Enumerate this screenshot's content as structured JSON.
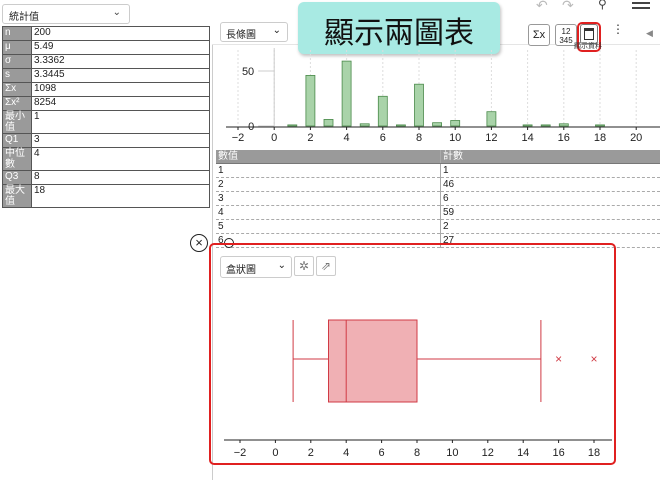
{
  "left_panel": {
    "dropdown": "統計值",
    "stats": [
      {
        "key": "n",
        "value": "200"
      },
      {
        "key": "μ",
        "value": "5.49"
      },
      {
        "key": "σ",
        "value": "3.3362"
      },
      {
        "key": "s",
        "value": "3.3445"
      },
      {
        "key": "Σx",
        "value": "1098"
      },
      {
        "key": "Σx²",
        "value": "8254"
      },
      {
        "key": "最小值",
        "value": "1"
      },
      {
        "key": "Q1",
        "value": "3"
      },
      {
        "key": "中位數",
        "value": "4"
      },
      {
        "key": "Q3",
        "value": "8"
      },
      {
        "key": "最大值",
        "value": "18"
      }
    ]
  },
  "toolbar": {
    "chart_type": "長條圖",
    "sigma_button": "Σx",
    "numbers_button_top": "12",
    "numbers_button_bottom": "345",
    "show_data_tooltip": "顯示資料"
  },
  "callout": {
    "text": "顯示兩圖表"
  },
  "bar_chart": {
    "y_ticks": [
      "50",
      "0"
    ],
    "x_ticks": [
      "−2",
      "0",
      "2",
      "4",
      "6",
      "8",
      "10",
      "12",
      "14",
      "16",
      "18",
      "20"
    ]
  },
  "data_table": {
    "headers": [
      "數值",
      "計數"
    ],
    "rows": [
      {
        "value": "1",
        "count": "1"
      },
      {
        "value": "2",
        "count": "46"
      },
      {
        "value": "3",
        "count": "6"
      },
      {
        "value": "4",
        "count": "59"
      },
      {
        "value": "5",
        "count": "2"
      },
      {
        "value": "6",
        "count": "27"
      }
    ]
  },
  "box_panel": {
    "chart_type": "盒狀圖",
    "x_ticks": [
      "−2",
      "0",
      "2",
      "4",
      "6",
      "8",
      "10",
      "12",
      "14",
      "16",
      "18",
      "20"
    ]
  },
  "chart_data": [
    {
      "type": "bar",
      "categories": [
        "1",
        "2",
        "3",
        "4",
        "5",
        "6",
        "7",
        "8",
        "9",
        "10",
        "11",
        "12",
        "13",
        "14",
        "15",
        "16",
        "17",
        "18"
      ],
      "values": [
        1,
        46,
        6,
        59,
        2,
        27,
        1,
        38,
        3,
        5,
        0,
        13,
        0,
        1,
        1,
        2,
        0,
        1
      ],
      "ylim": [
        0,
        60
      ],
      "xlim": [
        -2,
        21
      ]
    },
    {
      "type": "box",
      "min": 1,
      "q1": 3,
      "median": 4,
      "q3": 8,
      "whisker_high": 15,
      "outliers": [
        16,
        18
      ],
      "xlim": [
        -2,
        21
      ]
    }
  ],
  "colors": {
    "bar_fill": "#a9d3a9",
    "bar_stroke": "#4a8a4a",
    "box_fill": "#f0b0b4",
    "box_stroke": "#d03a44",
    "highlight": "#e02020",
    "callout": "#a8eae3"
  }
}
